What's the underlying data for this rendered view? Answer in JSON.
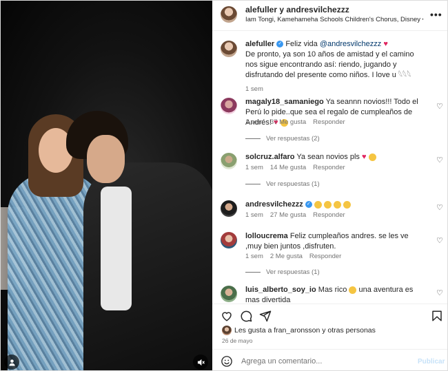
{
  "header": {
    "usernames": "alefuller y andresvilchezzz",
    "audio": "Iam Tongi, Kamehameha Schools Children's Chorus, Disney • Hawaiia..."
  },
  "caption": {
    "username": "alefuller",
    "mention_prefix": "Feliz vida ",
    "mention": "@andresvilchezzz",
    "text": "De pronto, ya son 10 años de amistad y el camino nos sigue encontrando así: riendo, jugando y disfrutando del presente como niños. I love u 𓆩𓆩𓆩",
    "time": "1 sem"
  },
  "comments": [
    {
      "username": "magaly18_samaniego",
      "text": "Ya seannn novios!!! Todo el Perú lo pide..que sea el regalo de cumpleaños de Andrés!",
      "time": "1 sem",
      "likes": "37 Me gusta",
      "reply": "Responder",
      "replies": "Ver respuestas (2)"
    },
    {
      "username": "solcruz.alfaro",
      "text": "Ya sean novios pls",
      "time": "1 sem",
      "likes": "14 Me gusta",
      "reply": "Responder",
      "replies": "Ver respuestas (1)"
    },
    {
      "username": "andresvilchezzz",
      "text": "",
      "time": "1 sem",
      "likes": "27 Me gusta",
      "reply": "Responder"
    },
    {
      "username": "lolloucrema",
      "text": "Feliz cumpleaños andres. se les ve ,muy bien juntos ,disfruten.",
      "time": "1 sem",
      "likes": "2 Me gusta",
      "reply": "Responder",
      "replies": "Ver respuestas (1)"
    },
    {
      "username": "luis_alberto_soy_io",
      "text": "Mas rico",
      "text2": "una aventura es mas divertida"
    }
  ],
  "likes_line": "Les gusta a fran_aronsson y otras personas",
  "date": "26 de mayo",
  "add_comment": {
    "placeholder": "Agrega un comentario...",
    "post_label": "Publicar"
  },
  "icons": {
    "heart": "heart-icon",
    "comment": "comment-icon",
    "share": "share-icon",
    "save": "bookmark-icon",
    "emoji": "emoji-icon",
    "more": "more-icon",
    "mute": "mute-icon",
    "tagged": "user-icon"
  }
}
